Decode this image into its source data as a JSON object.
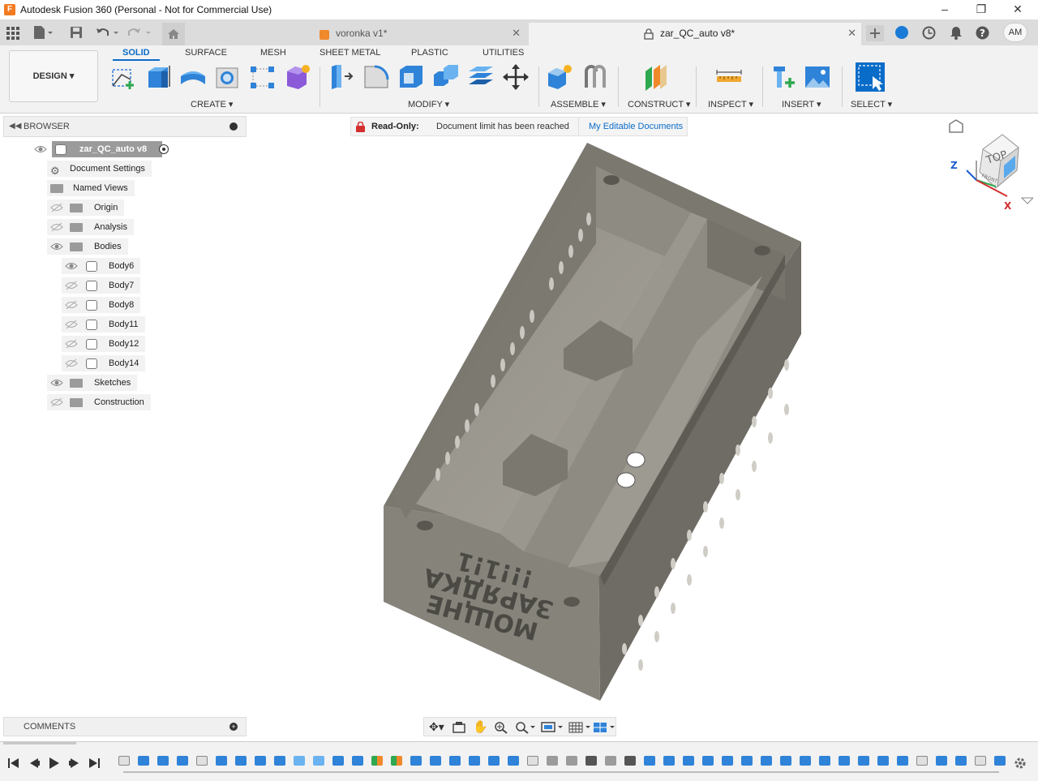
{
  "window": {
    "title": "Autodesk Fusion 360 (Personal - Not for Commercial Use)",
    "logo": "F"
  },
  "tabs": [
    {
      "label": "voronka v1*"
    },
    {
      "label": "zar_QC_auto v8*"
    }
  ],
  "avatar": "AM",
  "ribbon": {
    "design_label": "DESIGN",
    "tabs": [
      "SOLID",
      "SURFACE",
      "MESH",
      "SHEET METAL",
      "PLASTIC",
      "UTILITIES"
    ],
    "groups": [
      "CREATE",
      "MODIFY",
      "ASSEMBLE",
      "CONSTRUCT",
      "INSPECT",
      "INSERT",
      "SELECT"
    ]
  },
  "browser": {
    "title": "BROWSER",
    "root": "zar_QC_auto v8",
    "items": [
      {
        "label": "Document Settings"
      },
      {
        "label": "Named Views"
      },
      {
        "label": "Origin"
      },
      {
        "label": "Analysis"
      },
      {
        "label": "Bodies"
      },
      {
        "label": "Body6"
      },
      {
        "label": "Body7"
      },
      {
        "label": "Body8"
      },
      {
        "label": "Body11"
      },
      {
        "label": "Body12"
      },
      {
        "label": "Body14"
      },
      {
        "label": "Sketches"
      },
      {
        "label": "Construction"
      }
    ]
  },
  "banner": {
    "readonly_label": "Read-Only:",
    "message": "Document limit has been reached",
    "link": "My Editable Documents"
  },
  "viewcube": {
    "face": "TOP",
    "front": "FRONT",
    "axis_z": "Z",
    "axis_x": "X"
  },
  "model_text": {
    "line1": "МОЩНЕ",
    "line2": "ЗАРЯДКА",
    "line3": "!!!1!1"
  },
  "comments": {
    "title": "COMMENTS"
  },
  "colors": {
    "accent": "#0a6cc9",
    "model": "#7d7a72",
    "banner_red": "#d32f2f"
  }
}
